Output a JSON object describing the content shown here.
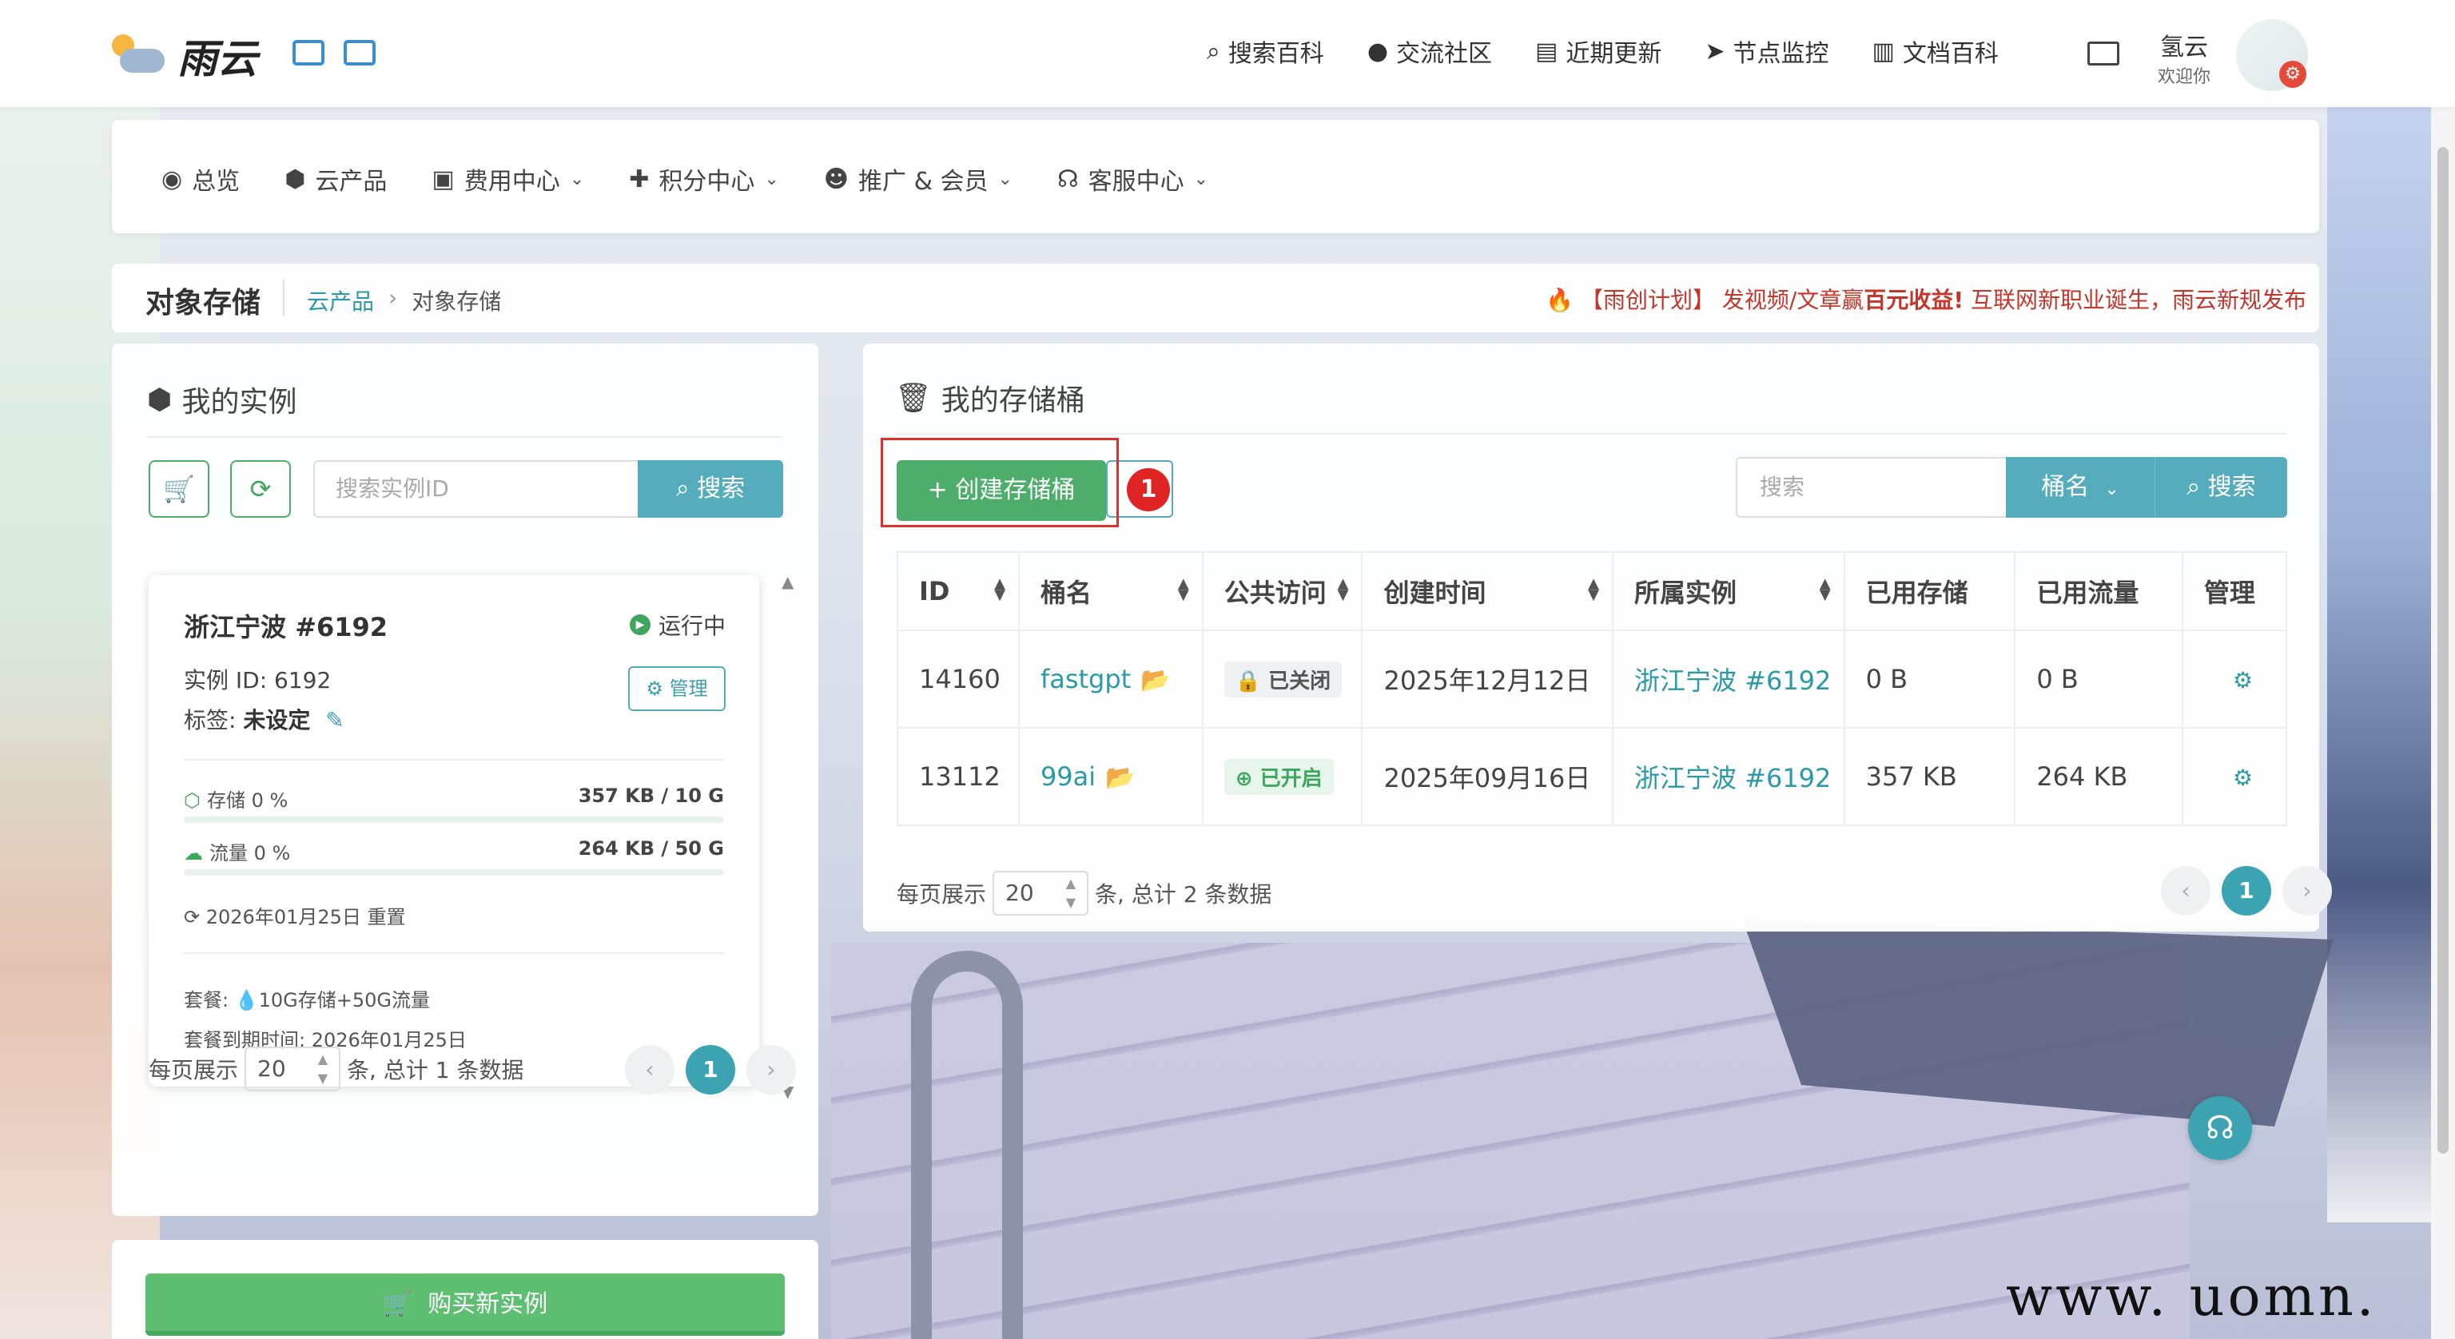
{
  "header": {
    "brand": "雨云",
    "nav": [
      {
        "icon": "search-icon",
        "glyph": "⌕",
        "label": "搜索百科"
      },
      {
        "icon": "community-icon",
        "glyph": "●",
        "label": "交流社区"
      },
      {
        "icon": "updates-icon",
        "glyph": "▤",
        "label": "近期更新"
      },
      {
        "icon": "monitor-icon",
        "glyph": "➤",
        "label": "节点监控"
      },
      {
        "icon": "docs-icon",
        "glyph": "▥",
        "label": "文档百科"
      }
    ],
    "user": {
      "name": "氢云",
      "greeting": "欢迎你"
    }
  },
  "subnav": [
    {
      "icon": "dashboard-icon",
      "glyph": "◉",
      "label": "总览",
      "dropdown": false
    },
    {
      "icon": "cubes-icon",
      "glyph": "⬢",
      "label": "云产品",
      "dropdown": false
    },
    {
      "icon": "money-icon",
      "glyph": "▣",
      "label": "费用中心",
      "dropdown": true
    },
    {
      "icon": "gift-icon",
      "glyph": "✚",
      "label": "积分中心",
      "dropdown": true
    },
    {
      "icon": "users-icon",
      "glyph": "☻",
      "label": "推广 & 会员",
      "dropdown": true
    },
    {
      "icon": "headset-icon",
      "glyph": "☊",
      "label": "客服中心",
      "dropdown": true
    }
  ],
  "breadcrumb": {
    "title": "对象存储",
    "parent": "云产品",
    "current": "对象存储",
    "announcement_prefix": "【雨创计划】 发视频/文章赢",
    "announcement_bold": "百元收益!",
    "announcement_suffix": " 互联网新职业诞生，雨云新规发布"
  },
  "left": {
    "title": "我的实例",
    "search_placeholder": "搜索实例ID",
    "search_button": "搜索",
    "instance": {
      "name": "浙江宁波 #6192",
      "status": "运行中",
      "id_label": "实例 ID: 6192",
      "manage": "管理",
      "tag_label": "标签:",
      "tag_value": "未设定",
      "storage_label": "存储 0 %",
      "storage_value": "357 KB / 10 G",
      "storage_percent": 0,
      "traffic_label": "流量 0 %",
      "traffic_value": "264 KB / 50 G",
      "traffic_percent": 0,
      "reset": "2026年01月25日 重置",
      "plan": "套餐: 💧10G存储+50G流量",
      "expire": "套餐到期时间: 2026年01月25日"
    },
    "pager": {
      "prefix": "每页展示",
      "size": "20",
      "suffix": "条, 总计 1 条数据",
      "current": "1"
    },
    "buy_button": "购买新实例"
  },
  "right": {
    "title": "我的存储桶",
    "create_button": "+ 创建存储桶",
    "marker": "1",
    "search_placeholder": "搜索",
    "filter_select": "桶名",
    "search_button": "搜索",
    "columns": [
      "ID",
      "桶名",
      "公共访问",
      "创建时间",
      "所属实例",
      "已用存储",
      "已用流量",
      "管理"
    ],
    "rows": [
      {
        "id": "14160",
        "name": "fastgpt",
        "access": "已关闭",
        "access_state": "closed",
        "created": "2025年12月12日",
        "instance": "浙江宁波 #6192",
        "storage": "0 B",
        "traffic": "0 B"
      },
      {
        "id": "13112",
        "name": "99ai",
        "access": "已开启",
        "access_state": "open",
        "created": "2025年09月16日",
        "instance": "浙江宁波 #6192",
        "storage": "357 KB",
        "traffic": "264 KB"
      }
    ],
    "pager": {
      "prefix": "每页展示",
      "size": "20",
      "suffix": "条, 总计 2 条数据",
      "current": "1"
    }
  },
  "watermark": "www. uomn. cn",
  "colors": {
    "accent": "#55acbc",
    "primary_green": "#4cae6a",
    "danger": "#e02d2d",
    "link": "#2a9aa8"
  }
}
